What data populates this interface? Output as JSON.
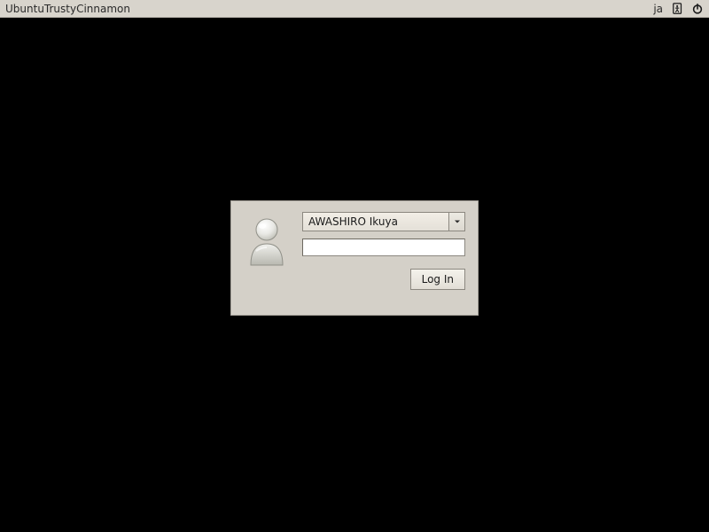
{
  "panel": {
    "hostname": "UbuntuTrustyCinnamon",
    "language_indicator": "ja"
  },
  "login": {
    "selected_user": "AWASHIRO Ikuya",
    "password_value": "",
    "login_button_label": "Log In"
  }
}
